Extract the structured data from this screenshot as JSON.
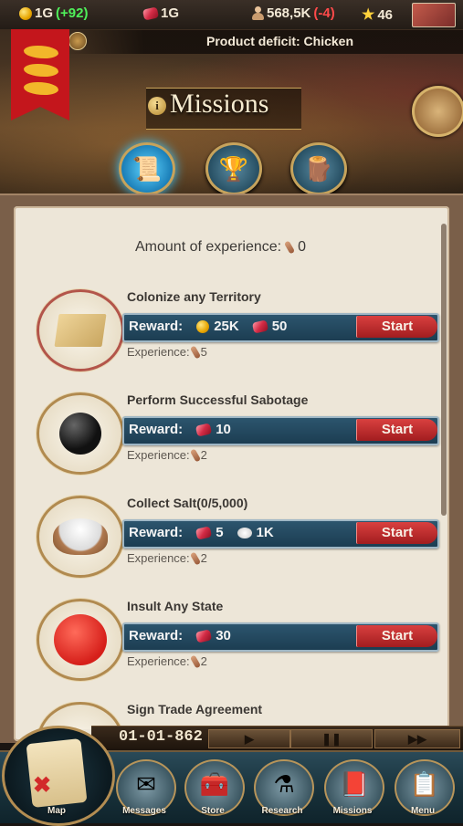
{
  "resources": {
    "gold": "1G",
    "gold_delta": "(+92)",
    "rubies": "1G",
    "population": "568,5K",
    "population_delta": "(-4)",
    "rating": "46"
  },
  "header": {
    "deficit": "Product deficit: Chicken",
    "title": "Missions",
    "info_glyph": "i"
  },
  "tabs": [
    {
      "icon": "scroll-icon"
    },
    {
      "icon": "trophy-icon"
    },
    {
      "icon": "resources-icon"
    }
  ],
  "experience": {
    "label": "Amount of experience:",
    "value": "0"
  },
  "missions": [
    {
      "title": "Colonize any Territory",
      "reward_label": "Reward:",
      "reward1": "25K",
      "reward2": "50",
      "start": "Start",
      "exp_label": "Experience:",
      "exp": "5"
    },
    {
      "title": "Perform Successful Sabotage",
      "reward_label": "Reward:",
      "reward1": "10",
      "start": "Start",
      "exp_label": "Experience:",
      "exp": "2"
    },
    {
      "title": "Collect Salt(0/5,000)",
      "reward_label": "Reward:",
      "reward1": "5",
      "reward2": "1K",
      "start": "Start",
      "exp_label": "Experience:",
      "exp": "2"
    },
    {
      "title": "Insult Any State",
      "reward_label": "Reward:",
      "reward1": "30",
      "start": "Start",
      "exp_label": "Experience:",
      "exp": "2"
    },
    {
      "title": "Sign Trade Agreement"
    }
  ],
  "bottom": {
    "date": "01-01-862",
    "play": "▶",
    "pause": "❚❚",
    "fast": "▶▶"
  },
  "nav": [
    {
      "label": "Map"
    },
    {
      "label": "Messages"
    },
    {
      "label": "Store"
    },
    {
      "label": "Research"
    },
    {
      "label": "Missions"
    },
    {
      "label": "Menu"
    }
  ],
  "colors": {
    "reward_bar": "#1c3d52",
    "start_button": "#a21d1f",
    "panel": "#ede6d8"
  }
}
